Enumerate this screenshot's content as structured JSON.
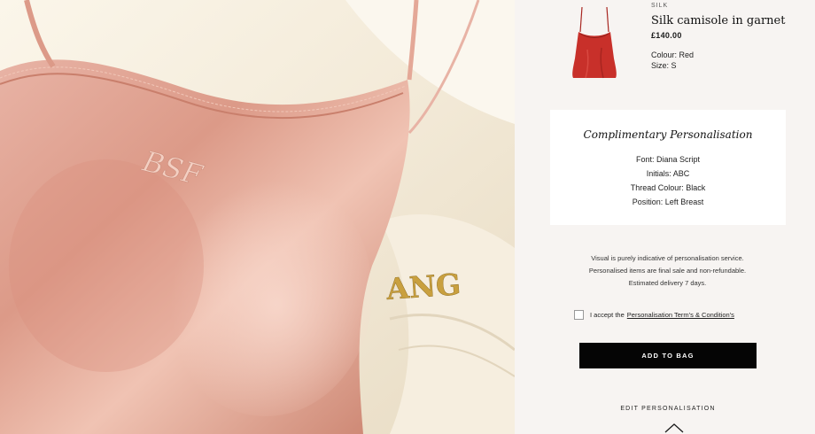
{
  "product": {
    "category": "SILK",
    "name": "Silk camisole in garnet",
    "price": "£140.00",
    "colour": "Colour: Red",
    "size": "Size: S"
  },
  "personalisation": {
    "title": "Complimentary Personalisation",
    "font": "Font: Diana Script",
    "initials": "Initials: ABC",
    "thread_colour": "Thread Colour: Black",
    "position": "Position: Left Breast"
  },
  "hero": {
    "monogram_pink": "BSF",
    "monogram_gold": "ANG"
  },
  "disclaimer": "Visual is purely indicative of personalisation service. Personalised items are final sale and non-refundable. Estimated delivery 7 days.",
  "terms": {
    "prefix": "I accept the",
    "link": "Personalisation Term's & Condition's",
    "checked": false
  },
  "add_to_bag": "ADD TO BAG",
  "edit_personalisation": "EDIT PERSONALISATION",
  "colors": {
    "button": "#050505",
    "panel_bg": "#f7f4f2",
    "card_bg": "#ffffff",
    "camisole_red": "#c8302a",
    "silk_pink": "#dc9d8d",
    "thread_gold": "#c9a03f"
  }
}
